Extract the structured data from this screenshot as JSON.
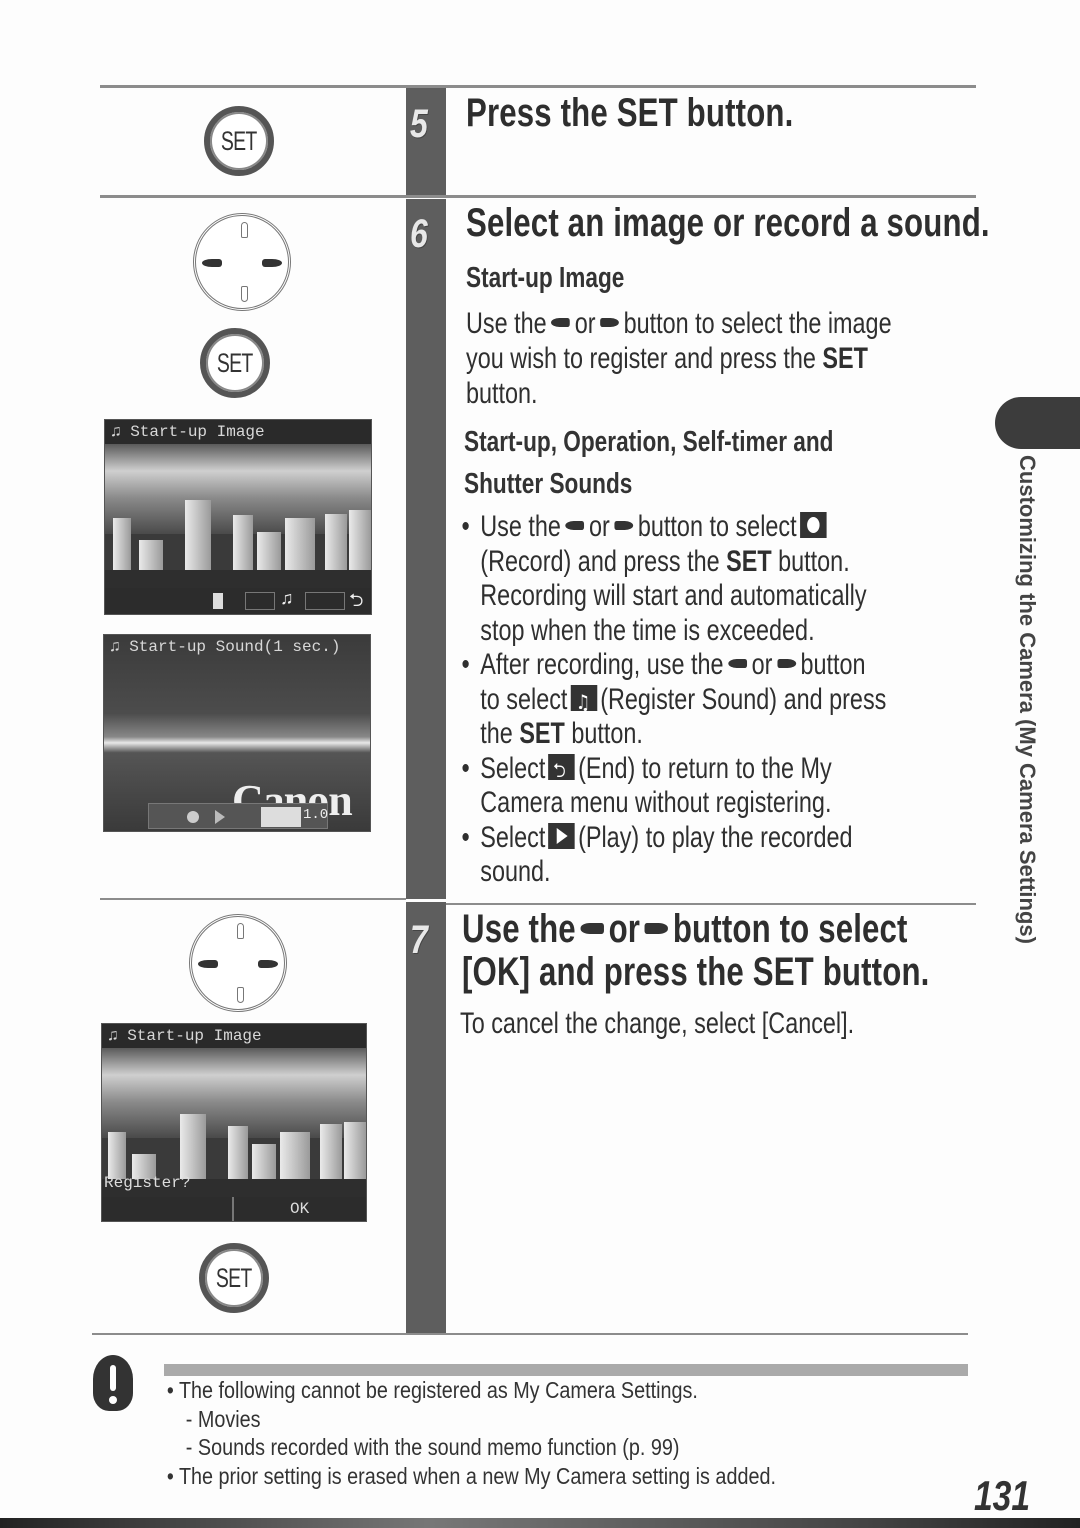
{
  "page": {
    "number": "131",
    "side_tab_label": "Customizing the Camera (My Camera Settings)"
  },
  "icons": {
    "set_button_label": "SET"
  },
  "steps": [
    {
      "number": "5",
      "title": "Press the SET button."
    },
    {
      "number": "6",
      "title": "Select an image or record a sound.",
      "sections": [
        {
          "heading": "Start-up Image",
          "text_parts": [
            "Use the",
            "or",
            "button to select the image",
            "you wish to register and press the",
            "SET",
            "button."
          ]
        },
        {
          "heading_line1": "Start-up, Operation, Self-timer and",
          "heading_line2": "Shutter Sounds",
          "bullets": [
            {
              "lines": [
                "Use the",
                "or",
                "button to select",
                "(Record) and press the",
                "SET",
                "button.",
                "Recording will start and automatically",
                "stop when the time is exceeded."
              ]
            },
            {
              "lines": [
                "After recording, use the",
                "or",
                "button",
                "to select",
                "(Register Sound) and press",
                "the",
                "SET",
                "button."
              ]
            },
            {
              "lines": [
                "Select",
                "(End) to return to the My",
                "Camera menu without registering."
              ]
            },
            {
              "lines": [
                "Select",
                "(Play) to play the recorded",
                "sound."
              ]
            }
          ]
        }
      ]
    },
    {
      "number": "7",
      "title_parts": [
        "Use the",
        "or",
        "button to select",
        "[OK] and press the SET button."
      ],
      "text": "To cancel the change, select [Cancel]."
    }
  ],
  "screens": [
    {
      "title": "Start-up Image"
    },
    {
      "title": "Start-up Sound(1 sec.)",
      "logo": "Canon",
      "counter": "1.0"
    },
    {
      "title": "Start-up Image",
      "prompt": "Register?",
      "ok_label": "OK"
    }
  ],
  "caution": {
    "notes": [
      "• The following cannot be registered as My Camera Settings.",
      "- Movies",
      "- Sounds recorded with the sound memo function (p. 99)",
      "• The prior setting is erased when a new My Camera setting is added."
    ]
  }
}
